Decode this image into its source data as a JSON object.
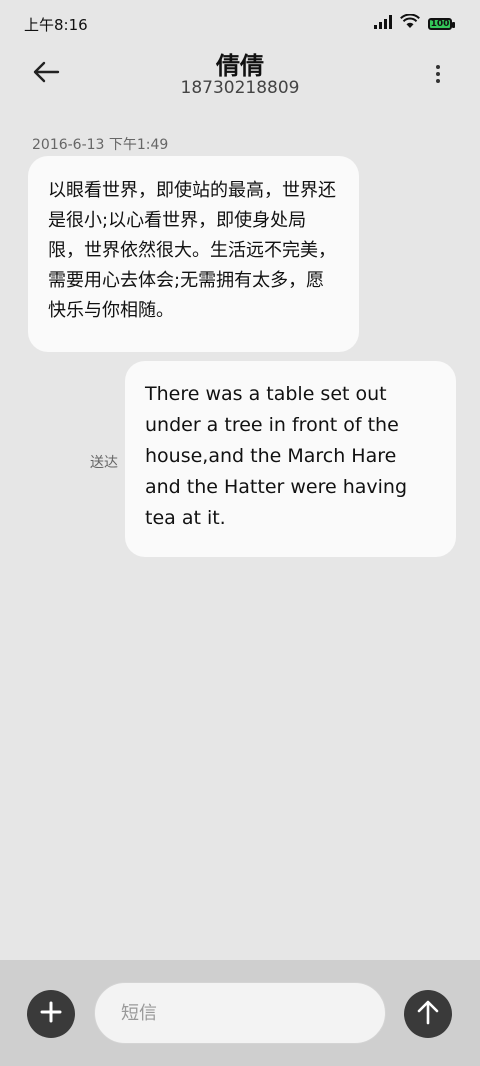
{
  "status_bar": {
    "time": "上午8:16",
    "battery": "100",
    "battery_color": "#34c759",
    "icons": [
      "signal-icon",
      "wifi-icon",
      "battery-icon"
    ]
  },
  "header": {
    "title": "倩倩",
    "subtitle": "18730218809",
    "back_icon": "arrow-left-icon",
    "more_icon": "more-vert-icon"
  },
  "conversation": {
    "timestamp": "2016-6-13 下午1:49",
    "messages": [
      {
        "direction": "incoming",
        "text": "以眼看世界，即使站的最高，世界还是很小;以心看世界，即使身处局限，世界依然很大。生活远不完美，需要用心去体会;无需拥有太多，愿快乐与你相随。"
      },
      {
        "direction": "outgoing",
        "text": "There was a table set out under a tree in front of the house,and the March Hare and the Hatter were having tea at it.",
        "status": "送达"
      }
    ]
  },
  "composer": {
    "placeholder": "短信",
    "value": "",
    "add_icon": "plus-icon",
    "send_icon": "arrow-up-icon"
  }
}
